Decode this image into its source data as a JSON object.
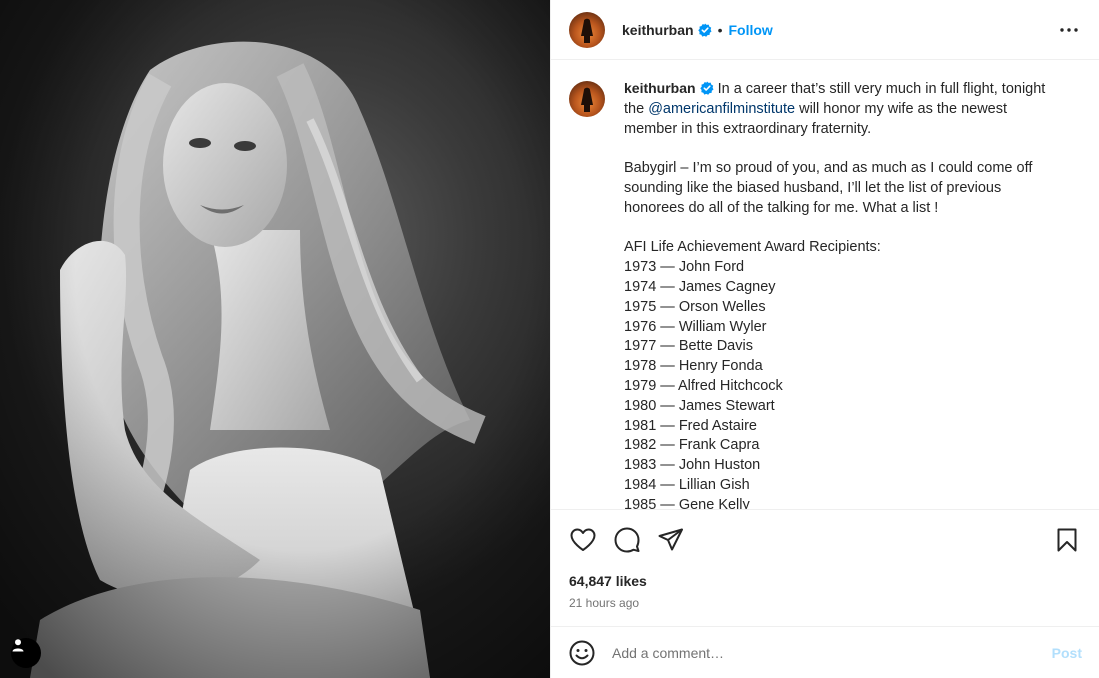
{
  "header": {
    "username": "keithurban",
    "separator": "•",
    "follow_label": "Follow"
  },
  "caption": {
    "username": "keithurban",
    "paragraph1_pre": "In a career that’s still very much in full flight, tonight the ",
    "mention": "@americanfilminstitute",
    "paragraph1_post": " will honor my wife as the newest member in this extraordinary fraternity.",
    "paragraph2": "Babygirl – I’m so proud of you, and as much as I could come off sounding like the biased husband, I’ll let the list of previous honorees do all of the talking for me. What a list !",
    "list_title": "AFI Life Achievement Award Recipients:",
    "list": [
      "1973 — John Ford",
      "1974 — James Cagney",
      "1975 — Orson Welles",
      "1976 — William Wyler",
      "1977 — Bette Davis",
      "1978 — Henry Fonda",
      "1979 — Alfred Hitchcock",
      "1980 — James Stewart",
      "1981 — Fred Astaire",
      "1982 — Frank Capra",
      "1983 — John Huston",
      "1984 — Lillian Gish",
      "1985 — Gene Kelly"
    ]
  },
  "icons": {
    "like": "heart-icon",
    "comment": "comment-icon",
    "share": "paper-plane-icon",
    "save": "bookmark-icon",
    "more": "more-dots-icon",
    "emoji": "smiley-icon",
    "user_tag": "user-tag-icon",
    "verified": "verified-badge-icon"
  },
  "stats": {
    "likes": "64,847 likes",
    "timestamp": "21 hours ago"
  },
  "comment": {
    "placeholder": "Add a comment…",
    "post_label": "Post"
  },
  "colors": {
    "accent": "#0095f6",
    "mention": "#00376b",
    "post_disabled": "#b2dffc",
    "muted": "#737373"
  }
}
